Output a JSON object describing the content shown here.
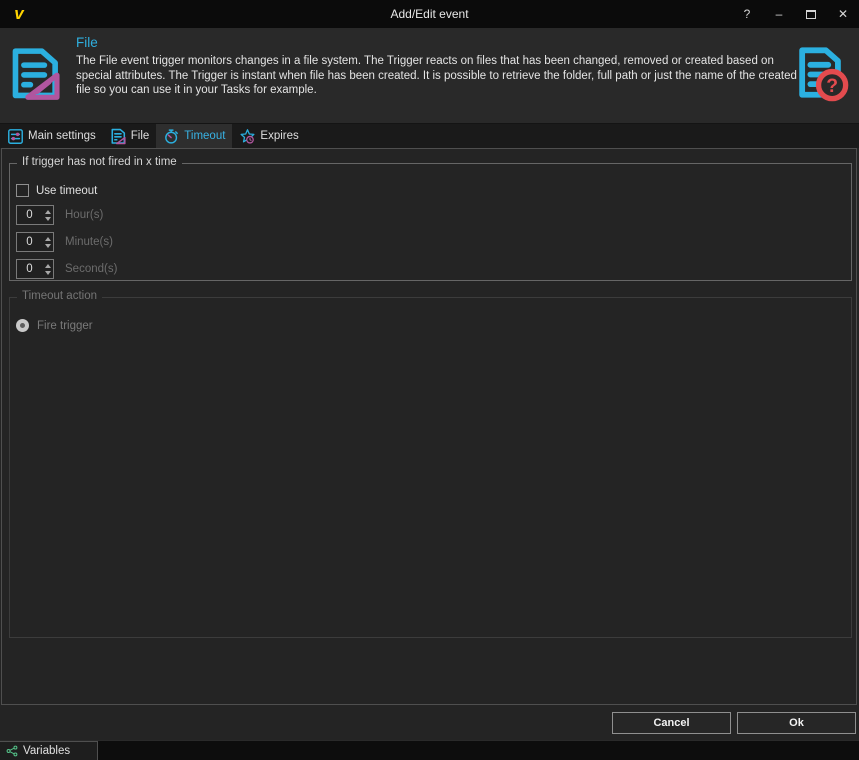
{
  "window": {
    "title": "Add/Edit event",
    "help_glyph": "?",
    "minimize_glyph": "–",
    "close_glyph": "✕"
  },
  "header": {
    "title": "File",
    "description_lines": [
      "The File event trigger monitors changes in a file system. The Trigger reacts on files that has been changed, removed or created based on",
      "special attributes. The Trigger is instant when file has been created. It is possible to retrieve the folder, full path or just the name of the created",
      "file so you can use it in your Tasks for example."
    ]
  },
  "tabs": [
    {
      "label": "Main settings",
      "icon": "sliders-icon",
      "selected": false
    },
    {
      "label": "File",
      "icon": "file-change-icon",
      "selected": false
    },
    {
      "label": "Timeout",
      "icon": "stopwatch-icon",
      "selected": true
    },
    {
      "label": "Expires",
      "icon": "star-clock-icon",
      "selected": false
    }
  ],
  "panel": {
    "group_title": "If trigger has not fired in x time",
    "use_timeout_label": "Use timeout",
    "use_timeout_checked": false,
    "spinners": [
      {
        "value": "0",
        "label": "Hour(s)"
      },
      {
        "value": "0",
        "label": "Minute(s)"
      },
      {
        "value": "0",
        "label": "Second(s)"
      }
    ],
    "action_group_title": "Timeout action",
    "fire_trigger_label": "Fire trigger",
    "fire_trigger_selected": true
  },
  "footer": {
    "cancel_label": "Cancel",
    "ok_label": "Ok"
  },
  "statusbar": {
    "variables_label": "Variables"
  },
  "colors": {
    "accent_cyan": "#2bb0e0",
    "accent_magenta": "#b0569f",
    "accent_red": "#e34b4e",
    "logo_yellow": "#ffd400",
    "variables_green": "#54c389"
  }
}
